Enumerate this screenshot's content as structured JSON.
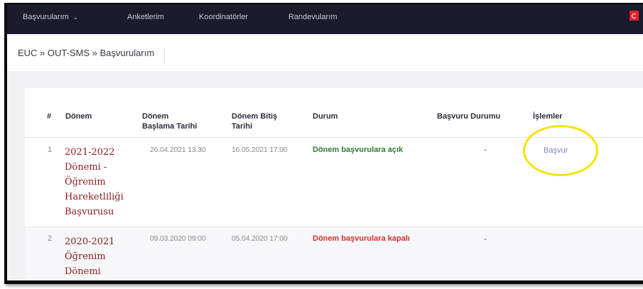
{
  "nav": {
    "items": [
      "Başvurularım",
      "Anketlerim",
      "Koordinatörler",
      "Randevularım"
    ],
    "flag_color": "#e32228"
  },
  "breadcrumb": "EUC » OUT-SMS » Başvurularım",
  "table": {
    "headers": {
      "num": "#",
      "period": "Dönem",
      "start_l1": "Dönem",
      "start_l2": "Başlama Tarihi",
      "end_l1": "Dönem Bitiş",
      "end_l2": "Tarihi",
      "status": "Durum",
      "app_status": "Başvuru Durumu",
      "actions": "İşlemler"
    },
    "rows": [
      {
        "num": "1",
        "period_lines": [
          "2021-2022",
          "Dönemi -",
          "Öğrenim",
          "Hareketliliği",
          "Başvurusu"
        ],
        "start": "26.04.2021 13:30",
        "end": "16.05.2021 17:00",
        "status": "Dönem başvurulara açık",
        "app_status": "-",
        "action": "Başvur"
      },
      {
        "num": "2",
        "period_lines": [
          "2020-2021",
          "Öğrenim",
          "Dönemi"
        ],
        "start": "09.03.2020 09:00",
        "end": "05.04.2020 17:00",
        "status": "Dönem başvurulara kapalı",
        "app_status": "-",
        "action": ""
      }
    ]
  },
  "colors": {
    "open": "#2e7d32",
    "closed": "#d32f2f",
    "period": "#8b1c1c",
    "highlight": "#f5e400"
  }
}
